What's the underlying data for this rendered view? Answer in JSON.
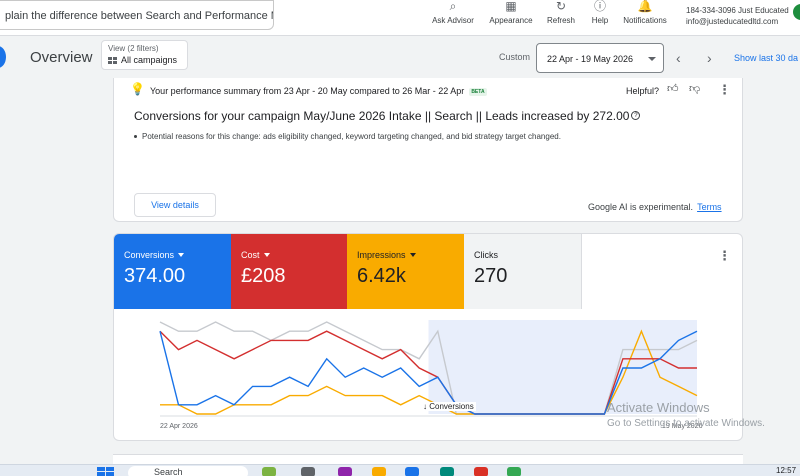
{
  "topbar": {
    "search_text": "plain the difference between Search and Performance Max cam...",
    "tools": [
      {
        "icon": "search-icon",
        "label": "Ask Advisor"
      },
      {
        "icon": "appearance-icon",
        "label": "Appearance"
      },
      {
        "icon": "refresh-icon",
        "label": "Refresh"
      },
      {
        "icon": "help-icon",
        "label": "Help"
      },
      {
        "icon": "bell-icon",
        "label": "Notifications"
      }
    ],
    "account_line1": "184-334-3096 Just Educated",
    "account_line2": "info@justeducatedltd.com"
  },
  "header": {
    "title": "Overview",
    "filter_view": "View (2 filters)",
    "filter_value": "All campaigns",
    "custom_label": "Custom",
    "date_range": "22 Apr - 19 May 2026",
    "show_last": "Show last 30 da"
  },
  "insight": {
    "summary": "Your performance summary from 23 Apr - 20 May compared to 26 Mar - 22 Apr",
    "beta": "BETA",
    "helpful": "Helpful?",
    "headline": "Conversions for your campaign May/June 2026 Intake || Search || Leads increased by 272.00",
    "bullet": "Potential reasons for this change: ads eligibility changed, keyword targeting changed, and bid strategy target changed.",
    "view_details": "View details",
    "ai_note": "Google AI is experimental.",
    "terms": "Terms"
  },
  "metrics": [
    {
      "name": "Conversions",
      "value": "374.00"
    },
    {
      "name": "Cost",
      "value": "£208"
    },
    {
      "name": "Impressions",
      "value": "6.42k"
    },
    {
      "name": "Clicks",
      "value": "270"
    }
  ],
  "colors": {
    "conversions": "#1a73e8",
    "cost": "#d32f2f",
    "impressions": "#f9ab00",
    "clicks": "#c6c9ce",
    "comparison_band": "#e8eefb"
  },
  "chart_data": {
    "type": "line",
    "x_start_label": "22 Apr 2026",
    "x_end_label": "19 May 2026",
    "marker_label": "Conversions",
    "series": [
      {
        "name": "Conversions",
        "values": [
          9,
          1,
          1,
          2,
          1,
          3,
          3,
          4,
          3,
          6,
          4,
          5,
          4,
          5,
          3,
          4,
          1,
          0,
          0,
          0,
          0,
          0,
          0,
          0,
          0,
          5,
          5,
          6,
          8,
          9
        ]
      },
      {
        "name": "Cost",
        "values": [
          9,
          7,
          8,
          7,
          6,
          7,
          8,
          8,
          8,
          9,
          8,
          7,
          6,
          7,
          5,
          4,
          1,
          0,
          0,
          0,
          0,
          0,
          0,
          0,
          0,
          6,
          6,
          6,
          5,
          5
        ]
      },
      {
        "name": "Impressions",
        "values": [
          1,
          1,
          0,
          0,
          1,
          1,
          1,
          2,
          2,
          3,
          2,
          2,
          2,
          1,
          2,
          1,
          0,
          0,
          0,
          0,
          0,
          0,
          0,
          0,
          0,
          4,
          9,
          4,
          3,
          2
        ]
      },
      {
        "name": "Clicks",
        "values": [
          10,
          9,
          9,
          10,
          9,
          9,
          8,
          9,
          9,
          10,
          9,
          8,
          7,
          7,
          6,
          9,
          0,
          0,
          0,
          0,
          0,
          0,
          0,
          0,
          0,
          7,
          7,
          7,
          7,
          8
        ]
      }
    ]
  },
  "watermark": {
    "line1": "Activate Windows",
    "line2": "Go to Settings to activate Windows."
  },
  "taskbar": {
    "search": "Search",
    "clock": "12:57"
  }
}
